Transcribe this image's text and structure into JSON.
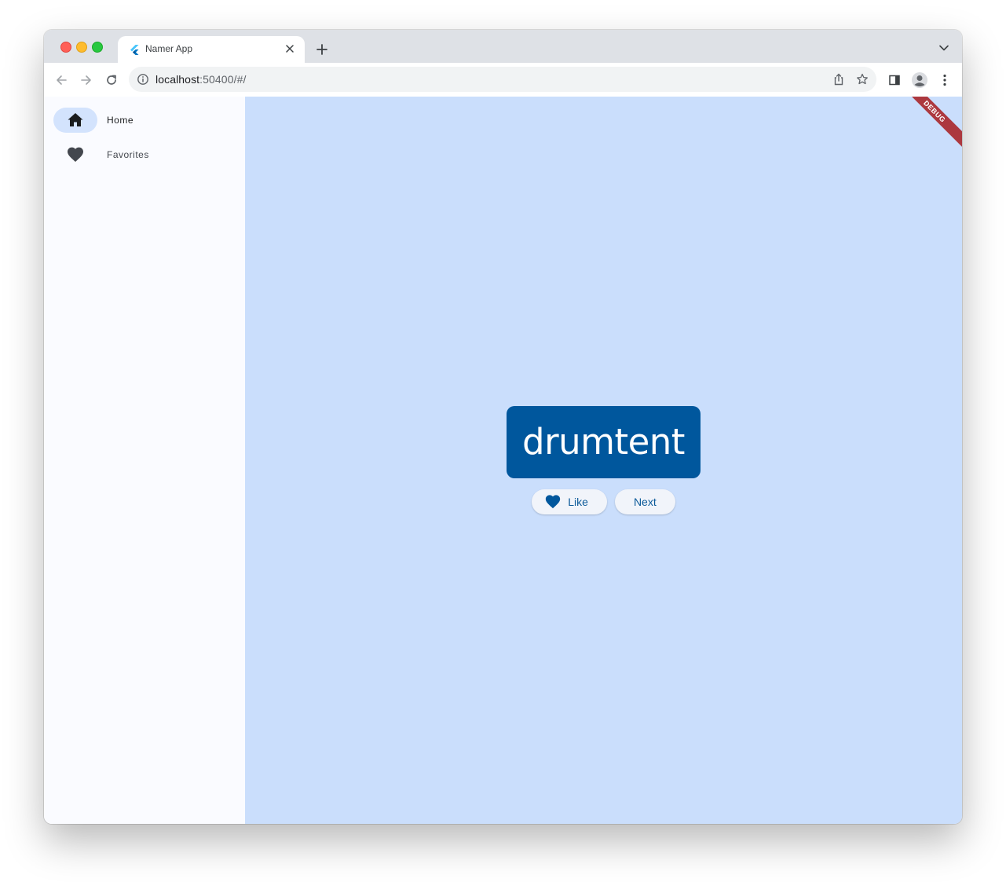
{
  "browser": {
    "tab": {
      "title": "Namer App"
    },
    "address": {
      "host": "localhost",
      "rest": ":50400/#/"
    }
  },
  "rail": {
    "items": [
      {
        "label": "Home",
        "icon": "home-icon",
        "selected": true
      },
      {
        "label": "Favorites",
        "icon": "heart-icon",
        "selected": false
      }
    ]
  },
  "main": {
    "word": "drumtent",
    "like_label": "Like",
    "next_label": "Next"
  },
  "debug_banner": "DEBUG",
  "colors": {
    "accent": "#00579d",
    "background": "#cadefc",
    "rail_indicator": "#d3e3fd"
  }
}
